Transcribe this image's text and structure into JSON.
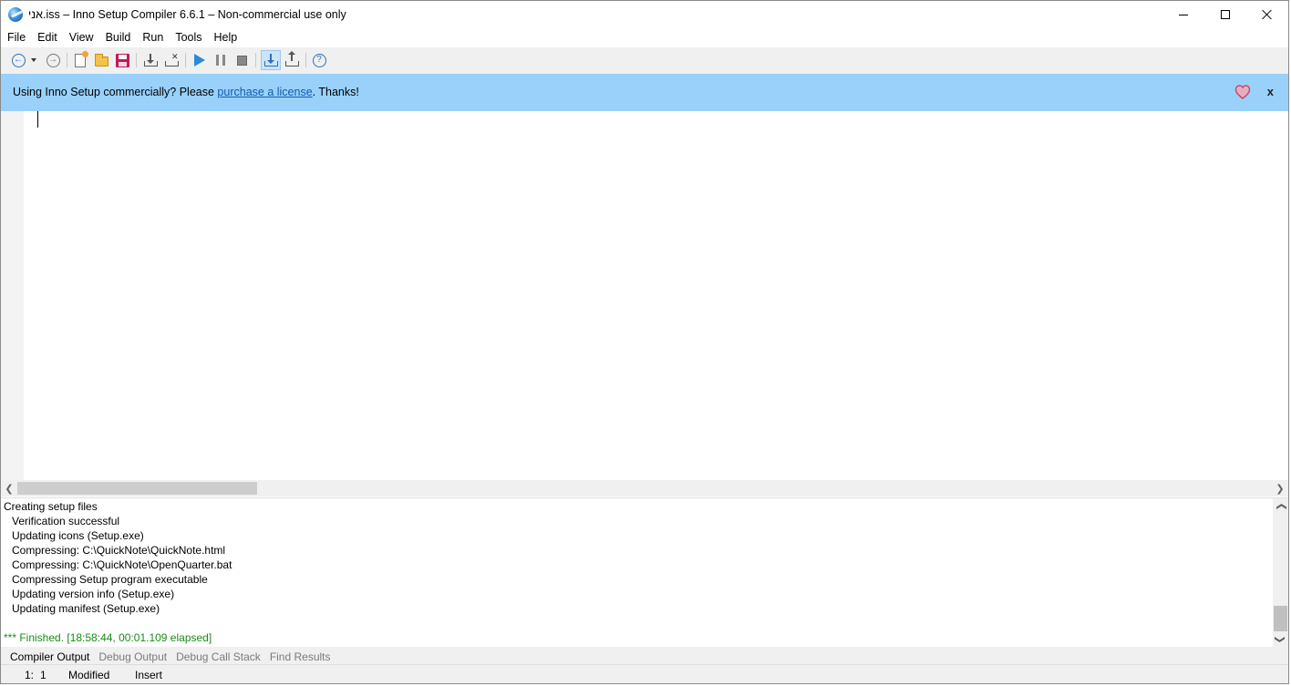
{
  "window": {
    "title": "אני.iss – Inno Setup Compiler 6.6.1 – Non-commercial use only"
  },
  "menu": [
    "File",
    "Edit",
    "View",
    "Build",
    "Run",
    "Tools",
    "Help"
  ],
  "toolbar": {
    "buttons": [
      "back-icon",
      "history-dropdown-icon",
      "forward-icon",
      "new-file-icon",
      "open-file-icon",
      "save-file-icon",
      "compile-icon",
      "stop-compile-icon",
      "run-icon",
      "pause-icon",
      "terminate-icon",
      "target-setup-icon",
      "target-uninstall-icon",
      "help-icon"
    ]
  },
  "banner": {
    "prefix": "Using Inno Setup commercially? Please ",
    "link": "purchase a license",
    "suffix": ". Thanks!",
    "close": "x",
    "background": "#99d1fb"
  },
  "output": {
    "lines": [
      "Creating setup files",
      "Verification successful",
      "Updating icons (Setup.exe)",
      "Compressing: C:\\QuickNote\\QuickNote.html",
      "Compressing: C:\\QuickNote\\OpenQuarter.bat",
      "Compressing Setup program executable",
      "Updating version info (Setup.exe)",
      "Updating manifest (Setup.exe)"
    ],
    "finished": "*** Finished.  [18:58:44, 00:01.109 elapsed]",
    "finished_color": "#1a8a1a"
  },
  "tabs": [
    "Compiler Output",
    "Debug Output",
    "Debug Call Stack",
    "Find Results"
  ],
  "status": {
    "line": "1:",
    "col": "1",
    "modified": "Modified",
    "mode": "Insert"
  }
}
